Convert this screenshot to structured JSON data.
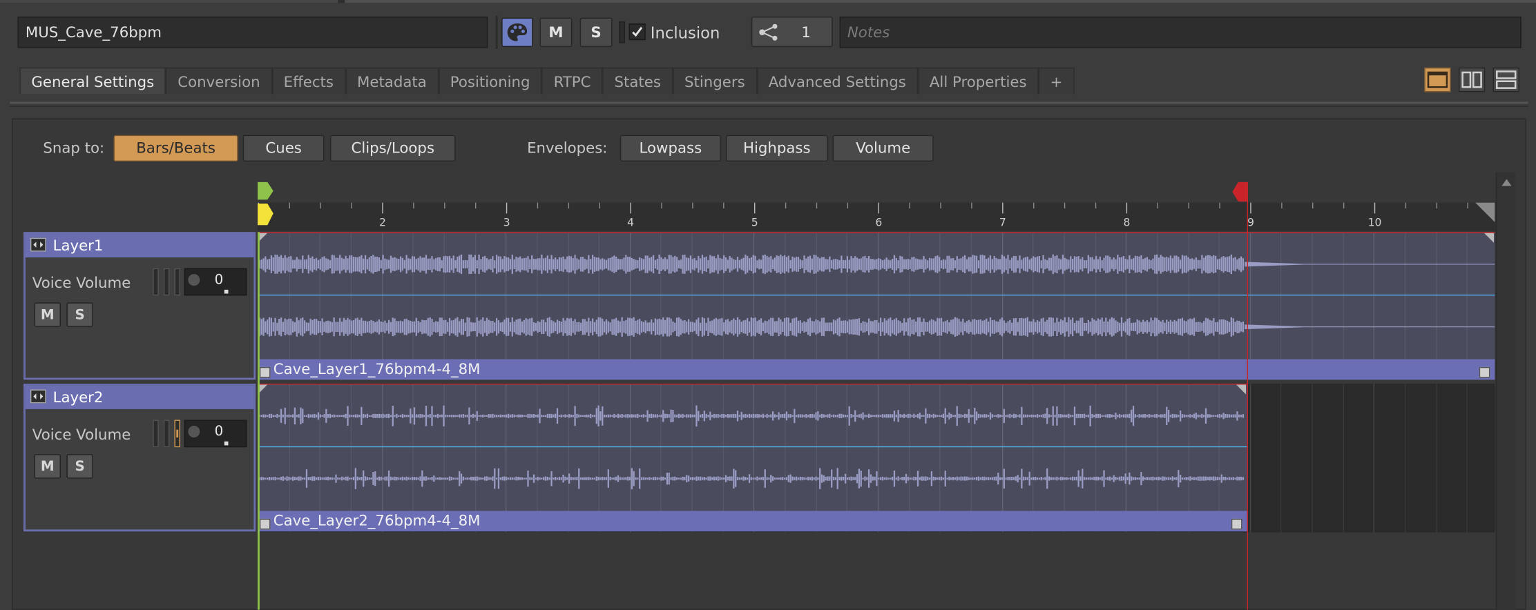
{
  "header": {
    "object_name": "MUS_Cave_76bpm",
    "mute_label": "M",
    "solo_label": "S",
    "inclusion_label": "Inclusion",
    "inclusion_checked": true,
    "share_count": "1",
    "notes_placeholder": "Notes"
  },
  "tabs": [
    {
      "label": "General Settings",
      "active": true
    },
    {
      "label": "Conversion"
    },
    {
      "label": "Effects"
    },
    {
      "label": "Metadata"
    },
    {
      "label": "Positioning"
    },
    {
      "label": "RTPC"
    },
    {
      "label": "States"
    },
    {
      "label": "Stingers"
    },
    {
      "label": "Advanced Settings"
    },
    {
      "label": "All Properties"
    },
    {
      "label": "+"
    }
  ],
  "toolbar": {
    "snap_label": "Snap to:",
    "snap_options": [
      "Bars/Beats",
      "Cues",
      "Clips/Loops"
    ],
    "snap_active": "Bars/Beats",
    "envelopes_label": "Envelopes:",
    "envelope_options": [
      "Lowpass",
      "Highpass",
      "Volume"
    ]
  },
  "ruler": {
    "labels": [
      "2",
      "3",
      "4",
      "5",
      "6",
      "7",
      "8",
      "9",
      "10"
    ]
  },
  "layers": [
    {
      "name": "Layer1",
      "prop_label": "Voice Volume",
      "value": "0",
      "mute": "M",
      "solo": "S",
      "clip_name": "Cave_Layer1_76bpm4-4_8M"
    },
    {
      "name": "Layer2",
      "prop_label": "Voice Volume",
      "value": "0",
      "mute": "M",
      "solo": "S",
      "clip_name": "Cave_Layer2_76bpm4-4_8M"
    }
  ],
  "colors": {
    "accent_orange": "#d39a55",
    "layer_purple": "#6a6eb0",
    "track_bg": "#4a4c5e",
    "waveform": "#9a9cc4",
    "center_line": "#4fb4e8",
    "play_marker_green": "#8fc24a",
    "entry_marker_yellow": "#f3e23a",
    "exit_marker_red": "#c8242a"
  },
  "icons": {
    "color_picker": "palette-icon",
    "share": "share-icon",
    "layout_single": "layout-single-icon",
    "layout_split_v": "layout-split-vertical-icon",
    "layout_split_h": "layout-split-horizontal-icon",
    "layer_expand": "expand-icon"
  }
}
